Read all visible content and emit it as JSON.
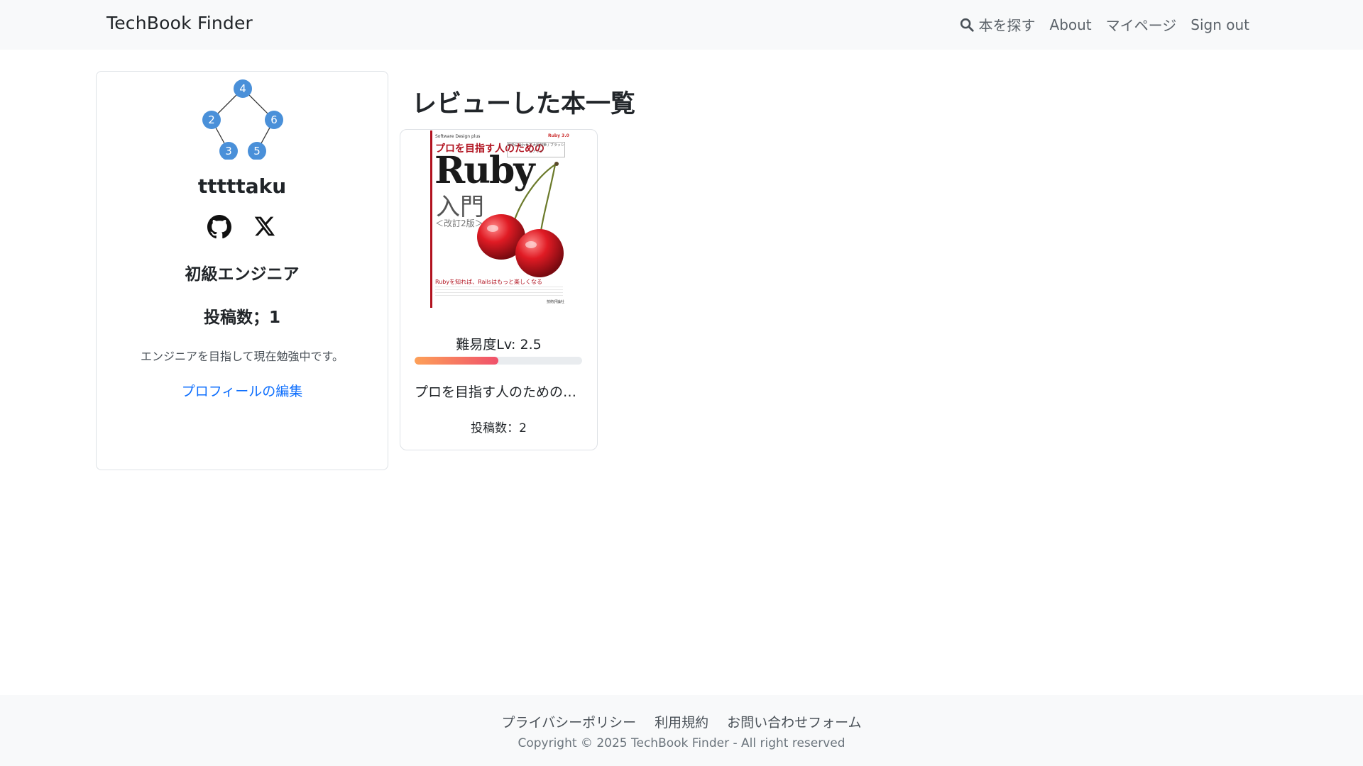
{
  "navbar": {
    "brand": "TechBook Finder",
    "search_label": "本を探す",
    "about_label": "About",
    "mypage_label": "マイページ",
    "signout_label": "Sign out"
  },
  "profile": {
    "tree_nodes": [
      "4",
      "2",
      "6",
      "3",
      "5"
    ],
    "username": "tttttaku",
    "rank": "初級エンジニア",
    "posts": "投稿数；1",
    "bio": "エンジニアを目指して現在勉強中です。",
    "edit_link": "プロフィールの編集"
  },
  "main": {
    "section_title": "レビューした本一覧",
    "books": [
      {
        "cover": {
          "series": "Software Design plus",
          "badge": "Ruby 3.0",
          "subtitle": "プロを目指す人のための",
          "note": "最新に合わせて大幅加筆 / ブラッシュアップ",
          "ruby": "Ruby",
          "nyumon": "入門",
          "edition": "＜改訂2版＞",
          "tagline": "Rubyを知れば、Railsはもっと楽しくなる",
          "publisher": "技術評論社"
        },
        "difficulty_label": "難易度Lv: 2.5",
        "difficulty_value": 2.5,
        "difficulty_max": 5,
        "title": "プロを目指す人のためのRuby入門",
        "posts": "投稿数：2"
      }
    ]
  },
  "footer": {
    "links": [
      "プライバシーポリシー",
      "利用規約",
      "お問い合わせフォーム"
    ],
    "copyright": "Copyright © 2025 TechBook Finder - All right reserved"
  },
  "colors": {
    "link": "#0d6efd",
    "tree_node": "#4a90d9",
    "progress_start": "#fda058",
    "progress_end": "#f0516b"
  }
}
